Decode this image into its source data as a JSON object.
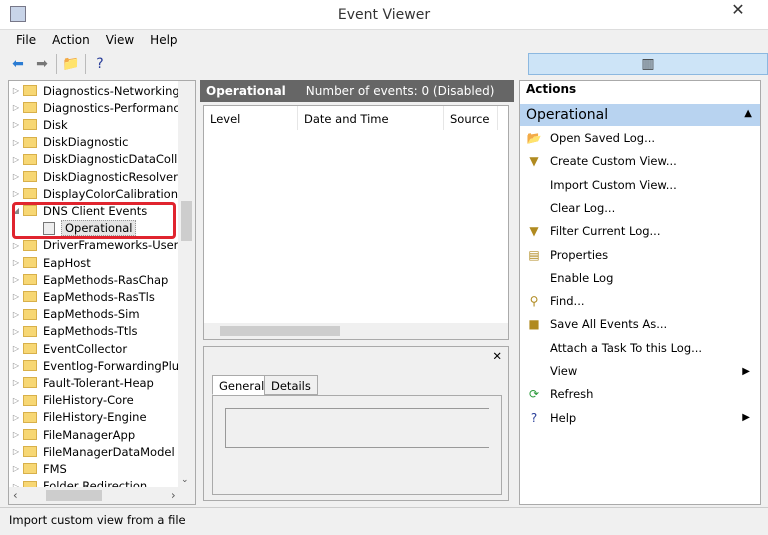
{
  "window": {
    "title": "Event Viewer",
    "close": "✕"
  },
  "menu": [
    "File",
    "Action",
    "View",
    "Help"
  ],
  "toolbar": [
    {
      "icon": "back-icon",
      "glyph": "⬅"
    },
    {
      "icon": "forward-icon",
      "glyph": "➡"
    },
    {
      "icon": "up-folder-icon",
      "glyph": "📁"
    },
    {
      "icon": "show-hide-console-tree-icon",
      "glyph": "▤"
    },
    {
      "icon": "help-icon",
      "glyph": "?"
    },
    {
      "icon": "show-hide-action-pane-icon",
      "glyph": "▥"
    }
  ],
  "tree": [
    "Diagnostics-Networking",
    "Diagnostics-Performance",
    "Disk",
    "DiskDiagnostic",
    "DiskDiagnosticDataCollec",
    "DiskDiagnosticResolver",
    "DisplayColorCalibration",
    "DNS Client Events",
    "Operational",
    "DriverFrameworks-UserMo",
    "EapHost",
    "EapMethods-RasChap",
    "EapMethods-RasTls",
    "EapMethods-Sim",
    "EapMethods-Ttls",
    "EventCollector",
    "Eventlog-ForwardingPlug",
    "Fault-Tolerant-Heap",
    "FileHistory-Core",
    "FileHistory-Engine",
    "FileManagerApp",
    "FileManagerDataModel",
    "FMS",
    "Folder Redirection"
  ],
  "middle": {
    "title": "Operational",
    "info": "Number of events: 0 (Disabled)",
    "columns": [
      "Level",
      "Date and Time",
      "Source"
    ],
    "tabs": [
      "General",
      "Details"
    ],
    "close": "✕"
  },
  "actions": {
    "header": "Actions",
    "section": "Operational",
    "items": [
      {
        "label": "Open Saved Log...",
        "icon": "open-folder-icon",
        "glyph": "📂"
      },
      {
        "label": "Create Custom View...",
        "icon": "filter-icon",
        "glyph": "▼"
      },
      {
        "label": "Import Custom View...",
        "icon": "",
        "glyph": ""
      },
      {
        "label": "Clear Log...",
        "icon": "",
        "glyph": ""
      },
      {
        "label": "Filter Current Log...",
        "icon": "filter-icon",
        "glyph": "▼"
      },
      {
        "label": "Properties",
        "icon": "properties-icon",
        "glyph": "▤"
      },
      {
        "label": "Enable Log",
        "icon": "",
        "glyph": ""
      },
      {
        "label": "Find...",
        "icon": "binoculars-icon",
        "glyph": "⚲"
      },
      {
        "label": "Save All Events As...",
        "icon": "save-icon",
        "glyph": "■"
      },
      {
        "label": "Attach a Task To this Log...",
        "icon": "",
        "glyph": ""
      },
      {
        "label": "View",
        "icon": "",
        "glyph": "",
        "submenu": true
      },
      {
        "label": "Refresh",
        "icon": "refresh-icon",
        "glyph": "⟳"
      },
      {
        "label": "Help",
        "icon": "help-icon",
        "glyph": "?",
        "submenu": true
      }
    ]
  },
  "status": "Import custom view from a file"
}
